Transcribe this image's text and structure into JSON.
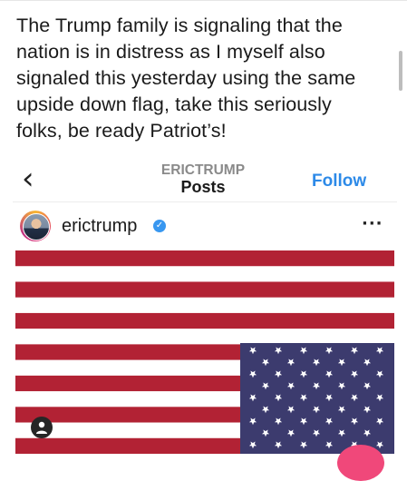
{
  "post": {
    "text": "The Trump family is signaling that the nation is in distress as I myself also signaled this yesterday using the same upside down flag, take this seriously folks, be ready Patriot’s!"
  },
  "embedded_screenshot": {
    "header": {
      "back_icon": "chevron-left-icon",
      "username_caption": "ERICTRUMP",
      "section_title": "Posts",
      "follow_label": "Follow"
    },
    "profile": {
      "username": "erictrump",
      "verified": true,
      "more_label": "···"
    },
    "image": {
      "subject": "upside-down-american-flag",
      "colors": {
        "red": "#b22234",
        "white": "#ffffff",
        "blue": "#3c3b6e"
      }
    }
  },
  "icons": [
    "chevron-left-icon",
    "verified-badge-icon",
    "more-options-icon",
    "user-tag-icon",
    "scrollbar-thumb"
  ]
}
